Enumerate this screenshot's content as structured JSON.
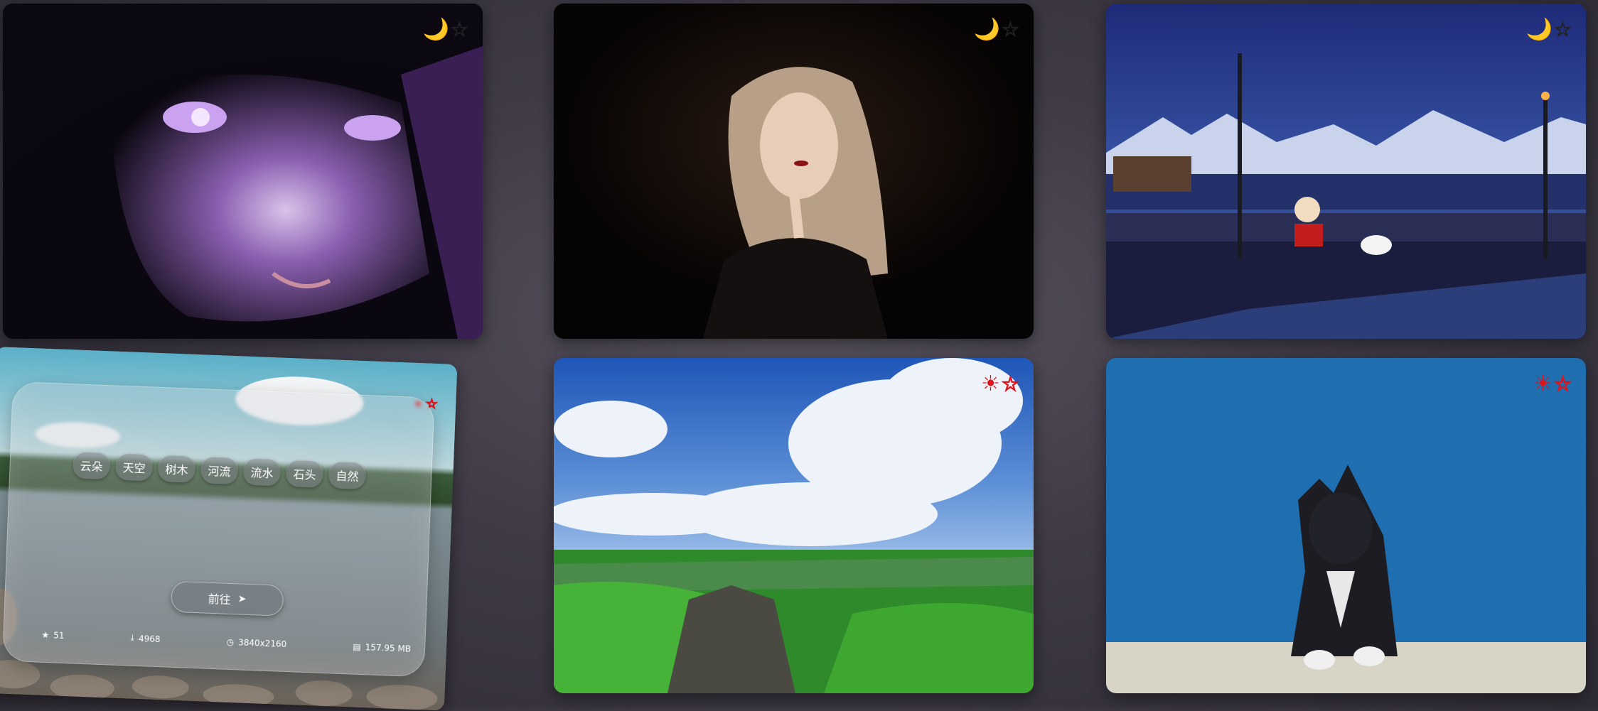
{
  "cards": [
    {
      "theme": "night",
      "theme_icon": "moon-icon",
      "fav_icon": "star-icon"
    },
    {
      "theme": "night",
      "theme_icon": "moon-icon",
      "fav_icon": "star-icon"
    },
    {
      "theme": "night",
      "theme_icon": "moon-icon",
      "fav_icon": "star-icon"
    },
    {
      "theme": "day",
      "theme_icon": "sun-icon",
      "fav_icon": "star-icon"
    },
    {
      "theme": "day",
      "theme_icon": "sun-icon",
      "fav_icon": "star-icon"
    },
    {
      "theme": "day",
      "theme_icon": "sun-icon",
      "fav_icon": "star-icon"
    }
  ],
  "detail": {
    "tags": [
      "云朵",
      "天空",
      "树木",
      "河流",
      "流水",
      "石头",
      "自然"
    ],
    "go_label": "前往",
    "stats": {
      "favorites": "51",
      "downloads": "4968",
      "resolution": "3840x2160",
      "size": "157.95 MB"
    }
  },
  "glyphs": {
    "moon": "🌙",
    "sun": "☀",
    "star": "☆",
    "arrow": "➤"
  },
  "colors": {
    "moon": "#f3c316",
    "sun": "#e0131a"
  }
}
